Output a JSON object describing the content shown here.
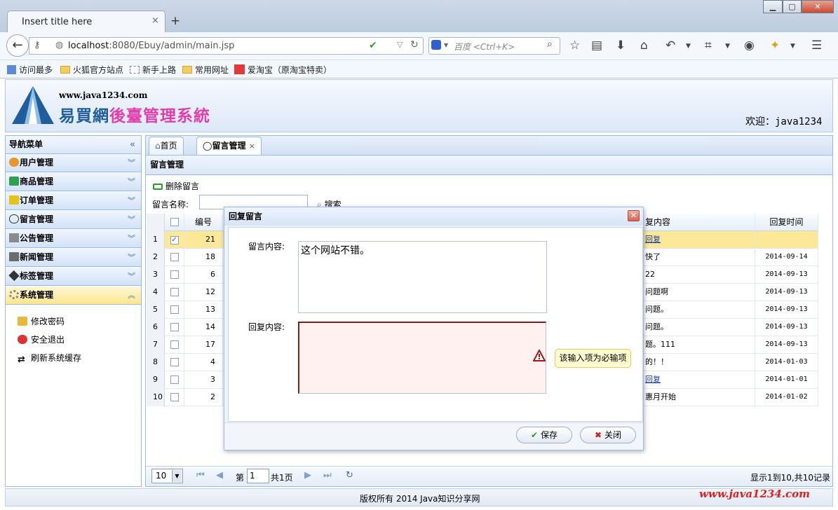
{
  "browser": {
    "tab_title": "Insert title here",
    "new_tab": "+",
    "url_host": "localhost",
    "url_rest": ":8080/Ebuy/admin/main.jsp",
    "search_placeholder": "百度 <Ctrl+K>",
    "bookmarks": [
      "访问最多",
      "火狐官方站点",
      "新手上路",
      "常用网址",
      "爱淘宝（原淘宝特卖）"
    ]
  },
  "header": {
    "site_url": "www.java1234.com",
    "title_part1": "易買網",
    "title_part2": "後臺管理系統",
    "welcome": "欢迎：java1234"
  },
  "nav": {
    "title": "导航菜单",
    "items": [
      {
        "label": "用户管理",
        "icon": "users-icon"
      },
      {
        "label": "商品管理",
        "icon": "goods-icon"
      },
      {
        "label": "订单管理",
        "icon": "order-icon"
      },
      {
        "label": "留言管理",
        "icon": "comment-icon"
      },
      {
        "label": "公告管理",
        "icon": "notice-icon"
      },
      {
        "label": "新闻管理",
        "icon": "news-icon"
      },
      {
        "label": "标签管理",
        "icon": "tag-icon"
      },
      {
        "label": "系统管理",
        "icon": "gear-icon"
      }
    ],
    "sub_items": [
      "修改密码",
      "安全退出",
      "刷新系统缓存"
    ]
  },
  "tabs": {
    "home": "首页",
    "active": "留言管理",
    "close": "×"
  },
  "panel": {
    "title": "留言管理",
    "delete_label": "删除留言",
    "name_label": "留言名称:",
    "search_label": "搜索"
  },
  "grid": {
    "col_id": "编号",
    "col_reply": "复内容",
    "col_time": "回复时间",
    "rows": [
      {
        "n": "1",
        "id": "21",
        "reply": "回复",
        "time": "",
        "checked": true,
        "link": true
      },
      {
        "n": "2",
        "id": "18",
        "reply": "快了",
        "time": "2014-09-14"
      },
      {
        "n": "3",
        "id": "6",
        "reply": "22",
        "time": "2014-09-13"
      },
      {
        "n": "4",
        "id": "12",
        "reply": "问题啊",
        "time": "2014-09-13"
      },
      {
        "n": "5",
        "id": "13",
        "reply": "问题。",
        "time": "2014-09-13"
      },
      {
        "n": "6",
        "id": "14",
        "reply": "问题。",
        "time": "2014-09-13"
      },
      {
        "n": "7",
        "id": "17",
        "reply": "题。111",
        "time": "2014-09-13"
      },
      {
        "n": "8",
        "id": "4",
        "reply": "的！！",
        "time": "2014-01-03"
      },
      {
        "n": "9",
        "id": "3",
        "reply": "回复",
        "time": "2014-01-01",
        "link": true
      },
      {
        "n": "10",
        "id": "2",
        "reply": "惠月开始",
        "time": "2014-01-02"
      }
    ]
  },
  "pager": {
    "page_size": "10",
    "page_prefix": "第",
    "page_number": "1",
    "page_total": "共1页",
    "info": "显示1到10,共10记录"
  },
  "dialog": {
    "title": "回复留言",
    "content_label": "留言内容:",
    "content_value": "这个网站不错。",
    "reply_label": "回复内容:",
    "reply_value": "",
    "validation_tip": "该输入项为必输项",
    "save_label": "保存",
    "close_label": "关闭"
  },
  "footer": {
    "copyright": "版权所有 2014 Java知识分享网",
    "watermark": "www.java1234.com"
  }
}
